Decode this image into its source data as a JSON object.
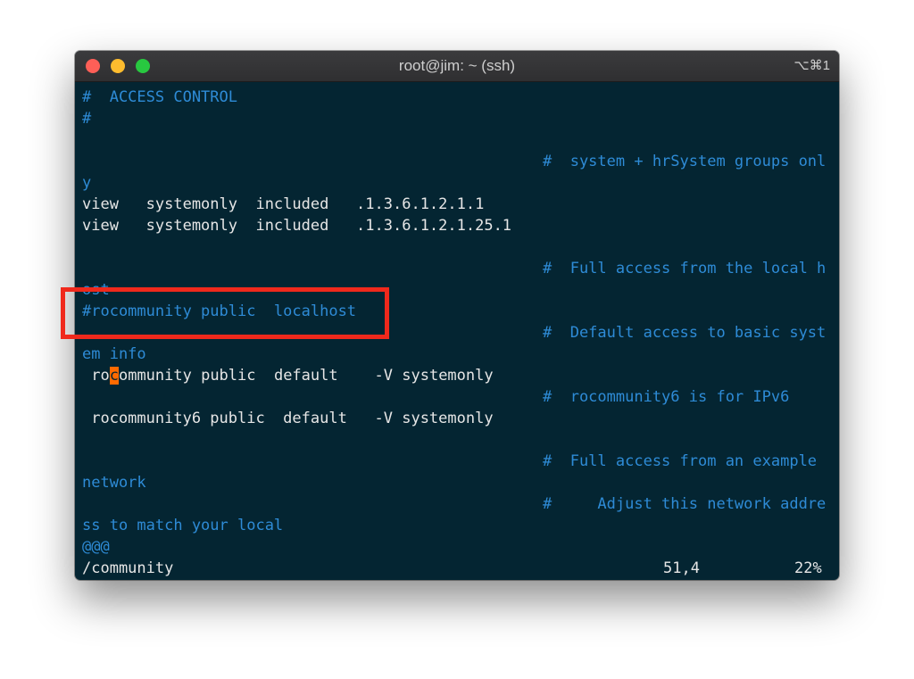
{
  "window": {
    "title": "root@jim: ~ (ssh)",
    "shortcut": "⌥⌘1"
  },
  "terminal": {
    "lines": [
      "#  ACCESS CONTROL",
      "#",
      "#  system + hrSystem groups onl",
      "y",
      "view   systemonly  included   .1.3.6.1.2.1.1",
      "view   systemonly  included   .1.3.6.1.2.1.25.1",
      "#  Full access from the local h",
      "ost",
      "#rocommunity public  localhost",
      "#  Default access to basic syst",
      "em info",
      " ro",
      "c",
      "ommunity public  default    -V systemonly",
      "#  rocommunity6 is for IPv6",
      " rocommunity6 public  default   -V systemonly",
      "#  Full access from an example",
      "network",
      "#     Adjust this network addre",
      "ss to match your local",
      "@@@"
    ],
    "status": {
      "command": "/community",
      "position": "51,4",
      "percent": "22%"
    }
  },
  "colors": {
    "background": "#042532",
    "comment": "#2e8bd6",
    "text": "#e6e6e6",
    "cursor": "#ff6a00",
    "highlight_box": "#f0291c"
  }
}
